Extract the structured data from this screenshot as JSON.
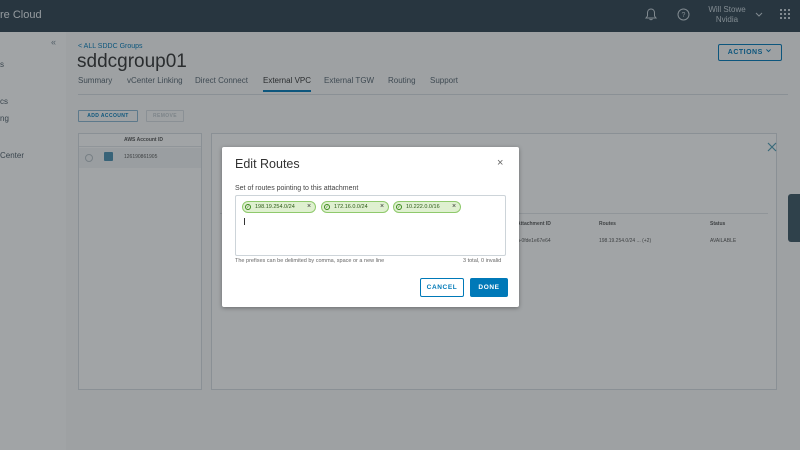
{
  "app": {
    "brand": "re Cloud"
  },
  "header": {
    "user_name": "Will Stowe",
    "org": "Nvidia"
  },
  "sidebar": {
    "collapse_glyph": "«",
    "items": [
      {
        "label": "s"
      },
      {
        "label": "cs"
      },
      {
        "label": "ng"
      },
      {
        "label": "Center"
      }
    ]
  },
  "page": {
    "breadcrumb": "< ALL SDDC Groups",
    "title": "sddcgroup01",
    "actions_label": "ACTIONS",
    "tabs": [
      {
        "label": "Summary"
      },
      {
        "label": "vCenter Linking"
      },
      {
        "label": "Direct Connect"
      },
      {
        "label": "External VPC",
        "active": true
      },
      {
        "label": "External TGW"
      },
      {
        "label": "Routing"
      },
      {
        "label": "Support"
      }
    ]
  },
  "accounts": {
    "add_button": "ADD ACCOUNT",
    "remove_button": "REMOVE",
    "column_header": "AWS Account ID",
    "rows": [
      {
        "account_id": "126190861905"
      }
    ]
  },
  "detail": {
    "columns": [
      "Attachment ID",
      "Routes",
      "Status"
    ],
    "row": {
      "attachment_id": "...attach-0fde1e67e64",
      "routes": "198.19.254.0/24 ... (+2)",
      "status": "AVAILABLE"
    }
  },
  "modal": {
    "title": "Edit Routes",
    "close_glyph": "×",
    "label": "Set of routes pointing to this attachment",
    "routes": [
      {
        "value": "198.19.254.0/24"
      },
      {
        "value": "172.16.0.0/24"
      },
      {
        "value": "10.222.0.0/16"
      }
    ],
    "hint": "The prefixes can be delimited by comma, space or a new line",
    "count": "3 total, 0 invalid",
    "cancel_label": "CANCEL",
    "done_label": "DONE"
  },
  "colors": {
    "topbar": "#2f4250",
    "accent": "#0079b8",
    "chip_bg": "#dff0d0",
    "chip_border": "#8fc96c"
  }
}
